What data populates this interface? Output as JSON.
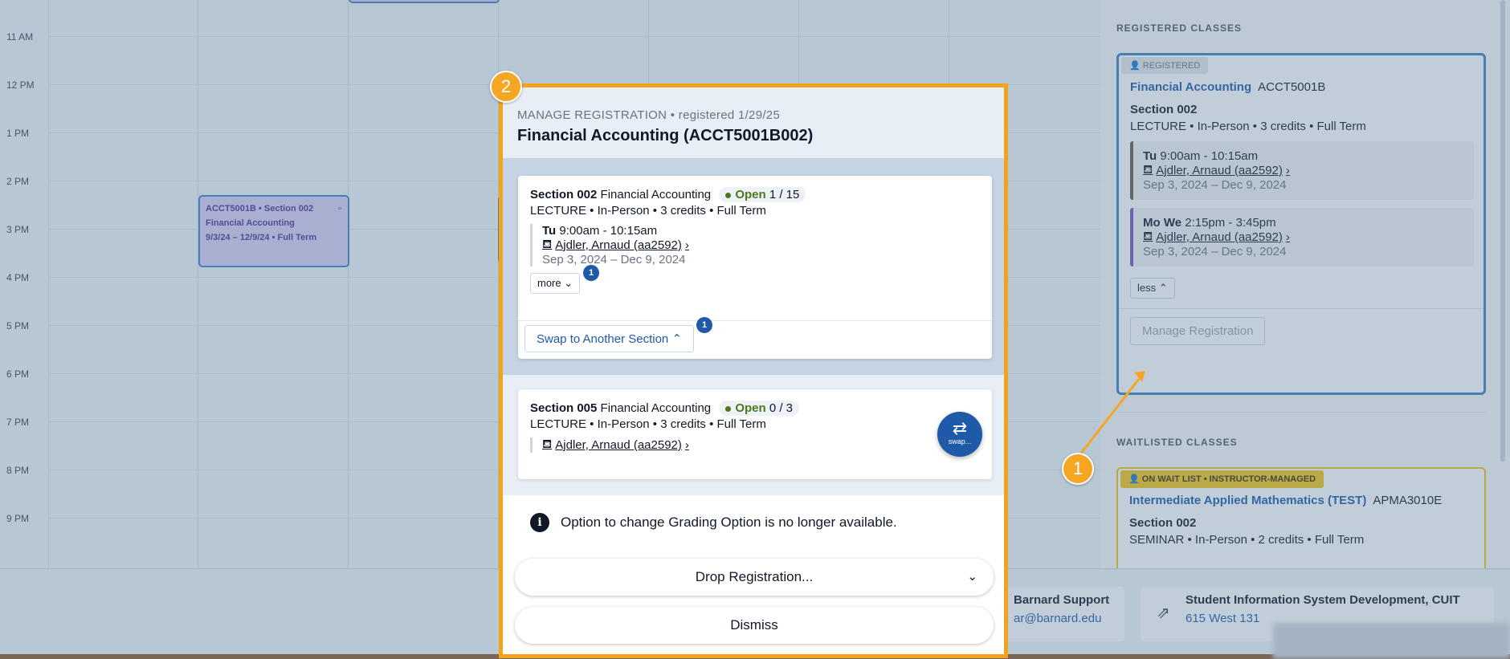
{
  "calendar": {
    "time_labels": [
      "11 AM",
      "12 PM",
      "1 PM",
      "2 PM",
      "3 PM",
      "4 PM",
      "5 PM",
      "6 PM",
      "7 PM",
      "8 PM",
      "9 PM"
    ],
    "event": {
      "line1": "ACCT5001B • Section 002",
      "line2": "Financial Accounting",
      "line3": "9/3/24 – 12/9/24 • Full Term"
    }
  },
  "right_panel": {
    "registered_heading": "REGISTERED CLASSES",
    "registered_card": {
      "tag": "REGISTERED",
      "course_title": "Financial Accounting",
      "course_number": "ACCT5001B",
      "section": "Section 002",
      "meta": "LECTURE • In-Person • 3 credits • Full Term",
      "meetings": [
        {
          "days": "Tu",
          "time": "9:00am - 10:15am",
          "instructor": "Ajdler, Arnaud (aa2592)",
          "dates": "Sep 3, 2024 – Dec 9, 2024",
          "bar_color": "#6b5a44"
        },
        {
          "days": "Mo We",
          "time": "2:15pm - 3:45pm",
          "instructor": "Ajdler, Arnaud (aa2592)",
          "dates": "Sep 3, 2024 – Dec 9, 2024",
          "bar_color": "#7e4fc4"
        }
      ],
      "less_label": "less",
      "manage_label": "Manage Registration"
    },
    "waitlisted_heading": "WAITLISTED CLASSES",
    "waitlist_card": {
      "tag": "ON WAIT LIST • INSTRUCTOR-MANAGED",
      "course_title": "Intermediate Applied Mathematics (TEST)",
      "course_number": "APMA3010E",
      "section": "Section 002",
      "meta": "SEMINAR • In-Person • 2 credits • Full Term"
    }
  },
  "footer": {
    "support1_name": "Barnard Support",
    "support1_link": "ar@barnard.edu",
    "support2_name": "Student Information System Development, CUIT",
    "support2_link": "615 West 131"
  },
  "modal": {
    "label": "MANAGE REGISTRATION",
    "separator": "•",
    "registered_date": "registered 1/29/25",
    "title": "Financial Accounting (ACCT5001B002)",
    "current_section": {
      "section": "Section 002",
      "course": "Financial Accounting",
      "status": "Open",
      "seats": "1 / 15",
      "meta": "LECTURE • In-Person • 3 credits • Full Term",
      "days": "Tu",
      "time": "9:00am - 10:15am",
      "instructor": "Ajdler, Arnaud (aa2592)",
      "dates": "Sep 3, 2024 – Dec 9, 2024",
      "more_label": "more",
      "more_badge": "1",
      "swap_label": "Swap to Another Section",
      "swap_badge": "1"
    },
    "alt_section": {
      "section": "Section 005",
      "course": "Financial Accounting",
      "status": "Open",
      "seats": "0 / 3",
      "meta": "LECTURE • In-Person • 3 credits • Full Term",
      "instructor": "Ajdler, Arnaud (aa2592)",
      "fab_label": "swap..."
    },
    "info_text": "Option to change Grading Option is no longer available.",
    "drop_label": "Drop Registration...",
    "dismiss_label": "Dismiss"
  },
  "callouts": {
    "one": "1",
    "two": "2"
  },
  "colors": {
    "accent": "#1e5aa8",
    "callout": "#f5a623",
    "open": "#4c7a1a",
    "waitlist": "#f5c518"
  }
}
